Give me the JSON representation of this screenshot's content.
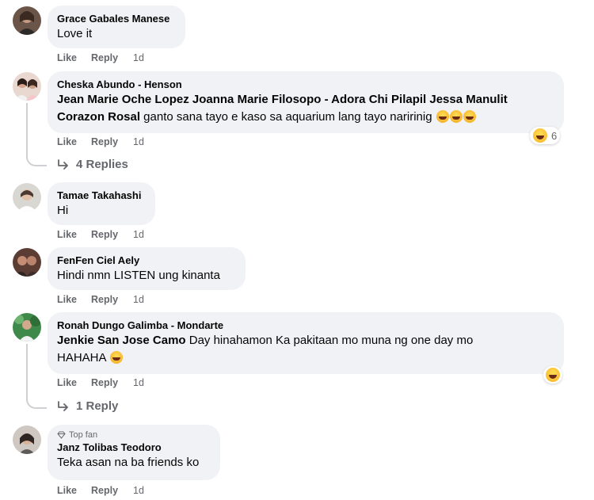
{
  "actions": {
    "like": "Like",
    "reply": "Reply"
  },
  "comments": [
    {
      "author": "Grace Gabales Manese",
      "text": "Love it",
      "time": "1d"
    },
    {
      "author": "Cheska Abundo - Henson",
      "tags": "Jean Marie Oche Lopez Joanna Marie Filosopo - Adora Chi Pilapil Jessa Manulit",
      "tags2": "Corazon Rosal",
      "text": " ganto sana tayo e kaso sa aquarium lang tayo naririnig ",
      "time": "1d",
      "reaction_count": "6",
      "replies": "4 Replies"
    },
    {
      "author": "Tamae Takahashi",
      "text": "Hi",
      "time": "1d"
    },
    {
      "author": "FenFen Ciel Aely",
      "text": "Hindi nmn LISTEN ung kinanta",
      "time": "1d"
    },
    {
      "author": "Ronah Dungo Galimba - Mondarte",
      "tags": "Jenkie San Jose Camo",
      "text": " Day hinahamon Ka pakitaan mo muna ng one day mo",
      "text2": "HAHAHA ",
      "time": "1d",
      "replies": "1 Reply"
    },
    {
      "badge": "Top fan",
      "author": "Janz Tolibas Teodoro",
      "text": "Teka asan na ba friends ko",
      "time": "1d"
    }
  ],
  "colors": {
    "bubble": "#f0f2f5",
    "meta": "#65676b",
    "text": "#050505"
  }
}
